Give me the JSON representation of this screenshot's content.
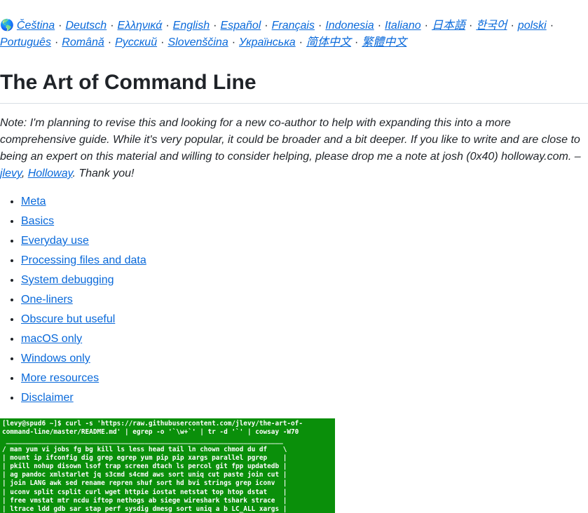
{
  "languages": {
    "globe_icon": "globe-icon",
    "line1": [
      "Čeština",
      "Deutsch",
      "Ελληνικά",
      "English",
      "Español",
      "Français",
      "Indonesia",
      "Italiano",
      "日本語",
      "한국어",
      "polski"
    ],
    "line2": [
      "Português",
      "Română",
      "Русский",
      "Slovenščina",
      "Українська",
      "简体中文",
      "繁體中文"
    ],
    "separator": "·"
  },
  "title": "The Art of Command Line",
  "note": {
    "text_before": "Note: I'm planning to revise this and looking for a new co-author to help with expanding this into a more comprehensive guide. While it's very popular, it could be broader and a bit deeper. If you like to write and are close to being an expert on this material and willing to consider helping, please drop me a note at josh (0x40) holloway.com. –",
    "link1": "jlevy",
    "comma": ", ",
    "link2": "Holloway",
    "text_after": ". Thank you!"
  },
  "toc": [
    "Meta",
    "Basics",
    "Everyday use",
    "Processing files and data",
    "System debugging",
    "One-liners",
    "Obscure but useful",
    "macOS only",
    "Windows only",
    "More resources",
    "Disclaimer"
  ],
  "terminal": {
    "lines": [
      "[levy@spud6 ~]$ curl -s 'https://raw.githubusercontent.com/jlevy/the-art-of-",
      "command-line/master/README.md' | egrep -o '`\\w+`' | tr -d '`' | cowsay -W70",
      " ______________________________________________________________________",
      "/ man yum vi jobs fg bg kill ls less head tail ln chown chmod du df    \\",
      "| mount ip ifconfig dig grep egrep yum pip pip xargs parallel pgrep    |",
      "| pkill nohup disown lsof trap screen dtach ls percol git fpp updatedb |",
      "| ag pandoc xmlstarlet jq s3cmd s4cmd aws sort uniq cut paste join cut |",
      "| join LANG awk sed rename repren shuf sort hd bvi strings grep iconv  |",
      "| uconv split csplit curl wget httpie iostat netstat top htop dstat    |",
      "| free vmstat mtr ncdu iftop nethogs ab siege wireshark tshark strace  |",
      "| ltrace ldd gdb sar stap perf sysdig dmesg sort uniq a b LC_ALL xargs |"
    ]
  }
}
